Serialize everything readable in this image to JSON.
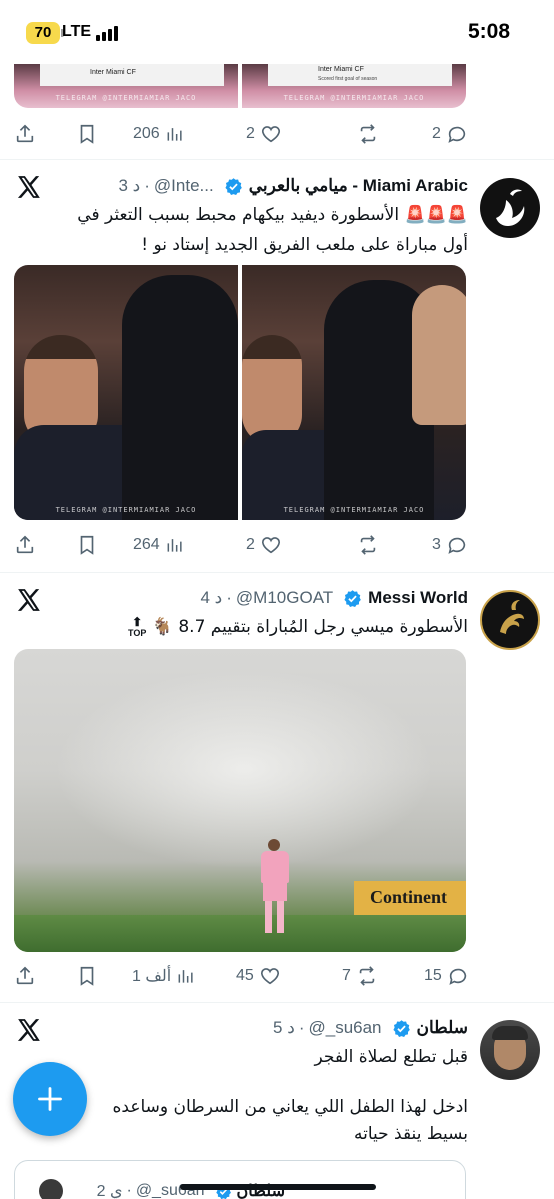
{
  "status_bar": {
    "battery": "70",
    "network": "LTE",
    "time": "5:08"
  },
  "tweet0": {
    "cards": [
      {
        "caption": "Inter Miami CF",
        "sub": ""
      },
      {
        "caption": "Inter Miami CF",
        "sub": "Scored first goal of season"
      }
    ],
    "watermark": "TELEGRAM @INTERMIAMIAR   JACO",
    "views": "206",
    "reposts": "",
    "likes": "2",
    "replies": "2"
  },
  "tweet1": {
    "name": "ميامي بالعربي - Miami Arabic",
    "handle": "@Inte...",
    "time": "3 د",
    "emoji": "🚨🚨🚨",
    "line1": "الأسطورة ديفيد بيكهام محبط بسبب التعثر في",
    "line2": "أول مباراة على ملعب الفريق الجديد إستاد نو !",
    "watermark": "TELEGRAM @INTERMIAMIAR   JACO",
    "views": "264",
    "likes": "2",
    "reposts": "",
    "replies": "3"
  },
  "tweet2": {
    "name": "Messi World",
    "handle": "@M10GOAT",
    "time": "4 د",
    "text": "الأسطورة ميسي رجل المُباراة بتقييم 8.7",
    "emoji_goat": "🐐",
    "emoji_top": "TOP",
    "banner": "Continent",
    "views": "1 ألف",
    "likes": "45",
    "reposts": "7",
    "replies": "15"
  },
  "tweet3": {
    "name": "سلطان",
    "handle": "@_su6an",
    "time": "5 د",
    "line1": "قبل تطلع لصلاة الفجر",
    "line2": "ادخل لهذا الطفل اللي يعاني من السرطان وساعده",
    "line3": "بسيط ينقذ حياته",
    "quote_name": "سلطان",
    "quote_handle": "@_su6an",
    "quote_time": "2 ي"
  },
  "colors": {
    "accent": "#1d9bf0",
    "muted": "#536471",
    "text": "#0f1419",
    "divider": "#eff3f4"
  },
  "icons": [
    "share-icon",
    "bookmark-icon",
    "views-icon",
    "like-icon",
    "repost-icon",
    "reply-icon",
    "x-logo-icon",
    "verified-icon",
    "compose-plus-icon"
  ]
}
